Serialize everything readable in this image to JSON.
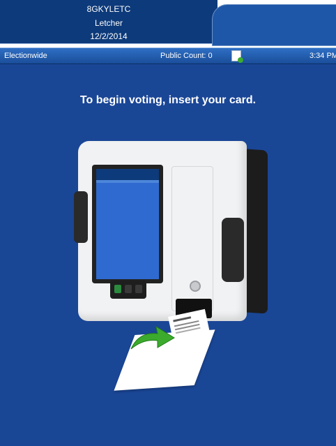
{
  "header": {
    "code": "8GKYLETC",
    "county": "Letcher",
    "date": "12/2/2014"
  },
  "status_bar": {
    "contest": "Electionwide",
    "public_count_label": "Public Count: 0",
    "doc_icon": "document-check-icon",
    "time": "3:34 PM"
  },
  "main": {
    "instruction": "To begin voting, insert your card."
  },
  "colors": {
    "header_dark": "#0d3a7a",
    "header_tab": "#1f57a8",
    "status_bar": "#2e6fc4",
    "background": "#1a4696",
    "arrow_green": "#3cab2d"
  }
}
